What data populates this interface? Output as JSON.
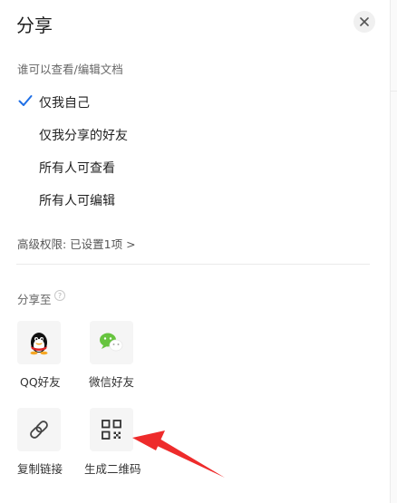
{
  "header": {
    "title": "分享"
  },
  "permissions": {
    "label": "谁可以查看/编辑文档",
    "options": [
      "仅我自己",
      "仅我分享的好友",
      "所有人可查看",
      "所有人可编辑"
    ],
    "selected_index": 0
  },
  "advanced": {
    "text": "高级权限: 已设置1项 >"
  },
  "share": {
    "label": "分享至",
    "help_glyph": "?",
    "targets": [
      {
        "label": "QQ好友",
        "icon": "qq-penguin-icon"
      },
      {
        "label": "微信好友",
        "icon": "wechat-icon"
      },
      {
        "label": "复制链接",
        "icon": "link-icon"
      },
      {
        "label": "生成二维码",
        "icon": "qr-code-icon"
      }
    ]
  },
  "colors": {
    "accent": "#1f6fe6",
    "arrow": "#ee2b2b",
    "wechat": "#67c43f"
  }
}
